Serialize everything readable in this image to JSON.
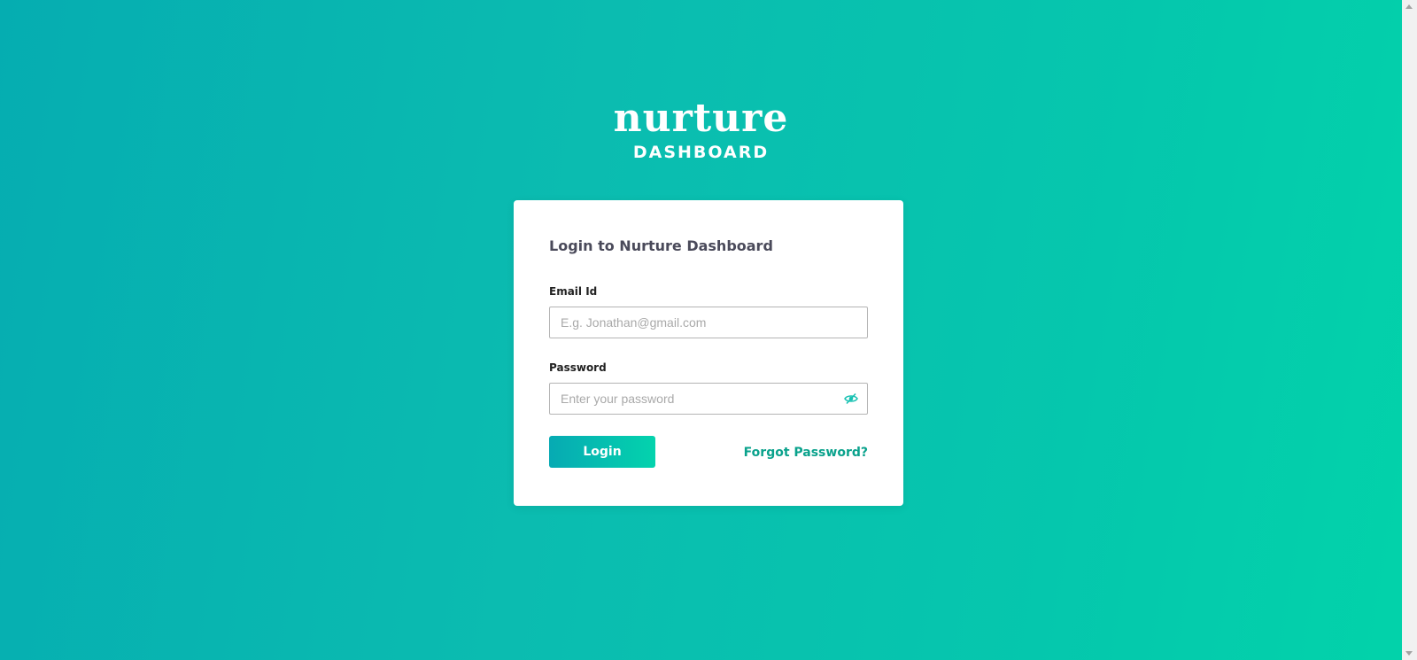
{
  "logo": {
    "word": "nurture",
    "sub": "DASHBOARD"
  },
  "login": {
    "title": "Login to Nurture Dashboard",
    "email_label": "Email Id",
    "email_value": "",
    "email_placeholder": "E.g. Jonathan@gmail.com",
    "password_label": "Password",
    "password_value": "",
    "password_placeholder": "Enter your password",
    "password_toggle_icon": "eye-slash-icon",
    "login_button": "Login",
    "forgot_link": "Forgot Password?"
  },
  "colors": {
    "background_start": "#05adb1",
    "background_end": "#02d3aa",
    "accent": "#0aa28c",
    "button_start": "#06aab3",
    "button_end": "#04d3ad",
    "icon": "#17c1b2"
  }
}
